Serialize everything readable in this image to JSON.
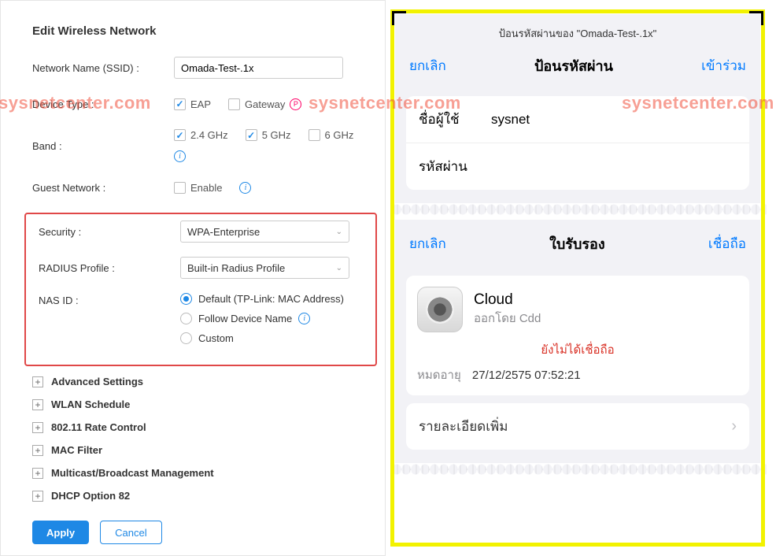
{
  "watermark": "sysnetcenter.com",
  "left": {
    "title": "Edit Wireless Network",
    "ssid_label": "Network Name (SSID) :",
    "ssid_value": "Omada-Test-.1x",
    "device_label": "Device Type :",
    "device_eap": "EAP",
    "device_gateway": "Gateway",
    "band_label": "Band :",
    "band_24": "2.4 GHz",
    "band_5": "5 GHz",
    "band_6": "6 GHz",
    "guest_label": "Guest Network :",
    "enable": "Enable",
    "security_label": "Security :",
    "security_value": "WPA-Enterprise",
    "radius_label": "RADIUS Profile :",
    "radius_value": "Built-in Radius Profile",
    "nas_label": "NAS ID :",
    "nas_default": "Default (TP-Link: MAC Address)",
    "nas_follow": "Follow Device Name",
    "nas_custom": "Custom",
    "exp": {
      "advanced": "Advanced Settings",
      "wlan": "WLAN Schedule",
      "rate": "802.11 Rate Control",
      "mac": "MAC Filter",
      "multicast": "Multicast/Broadcast Management",
      "dhcp": "DHCP Option 82"
    },
    "apply": "Apply",
    "cancel": "Cancel"
  },
  "phone1": {
    "subtitle": "ป้อนรหัสผ่านของ \"Omada-Test-.1x\"",
    "cancel": "ยกเลิก",
    "title": "ป้อนรหัสผ่าน",
    "join": "เข้าร่วม",
    "user_label": "ชื่อผู้ใช้",
    "user_value": "sysnet",
    "pass_label": "รหัสผ่าน"
  },
  "phone2": {
    "cancel": "ยกเลิก",
    "title": "ใบรับรอง",
    "trust": "เชื่อถือ",
    "cert_name": "Cloud",
    "cert_issuer": "ออกโดย Cdd",
    "not_trusted": "ยังไม่ได้เชื่อถือ",
    "expiry_label": "หมดอายุ",
    "expiry_value": "27/12/2575 07:52:21",
    "more": "รายละเอียดเพิ่ม"
  }
}
